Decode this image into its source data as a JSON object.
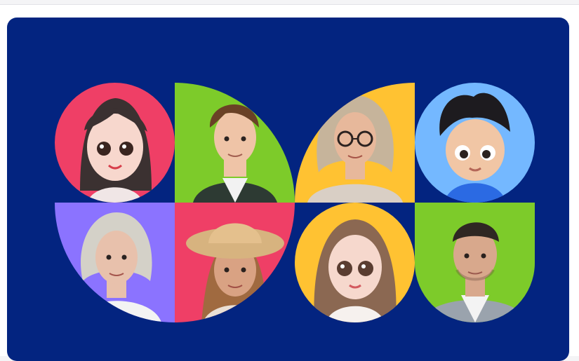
{
  "colors": {
    "banner_bg": "#032480",
    "pink": "#ef3f66",
    "green": "#7dcb2a",
    "yellow": "#ffc232",
    "light_blue": "#74b8ff",
    "purple": "#8b73ff"
  },
  "avatars": [
    {
      "kind": "cartoon-girl-avatar",
      "bg": "#ef3f66",
      "hair": "#3b3131",
      "skin": "#f7d7cd",
      "shirt": "#f0e6e6"
    },
    {
      "kind": "young-man-portrait",
      "bg": "#7dcb2a",
      "hair": "#6a4126",
      "skin": "#efc4a7",
      "shirt": "#2d3a33"
    },
    {
      "kind": "woman-glasses-portrait",
      "bg": "#ffc232",
      "hair": "#c6b49b",
      "skin": "#e7b89b",
      "shirt": "#d9cfc5"
    },
    {
      "kind": "cartoon-boy-avatar",
      "bg": "#74b8ff",
      "hair": "#1d1b1f",
      "skin": "#f1c6a5",
      "shirt": "#2b6ae3"
    },
    {
      "kind": "older-woman-portrait",
      "bg": "#8b73ff",
      "hair": "#d4d1c8",
      "skin": "#e8c1ac",
      "shirt": "#f3f3f3"
    },
    {
      "kind": "woman-hat-portrait",
      "bg": "#ef3f66",
      "hair": "#a06a40",
      "skin": "#d9a283",
      "shirt": "#eadfd5"
    },
    {
      "kind": "cartoon-woman-avatar",
      "bg": "#ffc232",
      "hair": "#8b6852",
      "skin": "#f6d8cd",
      "shirt": "#f6f1ee"
    },
    {
      "kind": "man-suit-portrait",
      "bg": "#7dcb2a",
      "hair": "#2f2723",
      "skin": "#d8a88c",
      "shirt": "#9aa3ad"
    }
  ]
}
